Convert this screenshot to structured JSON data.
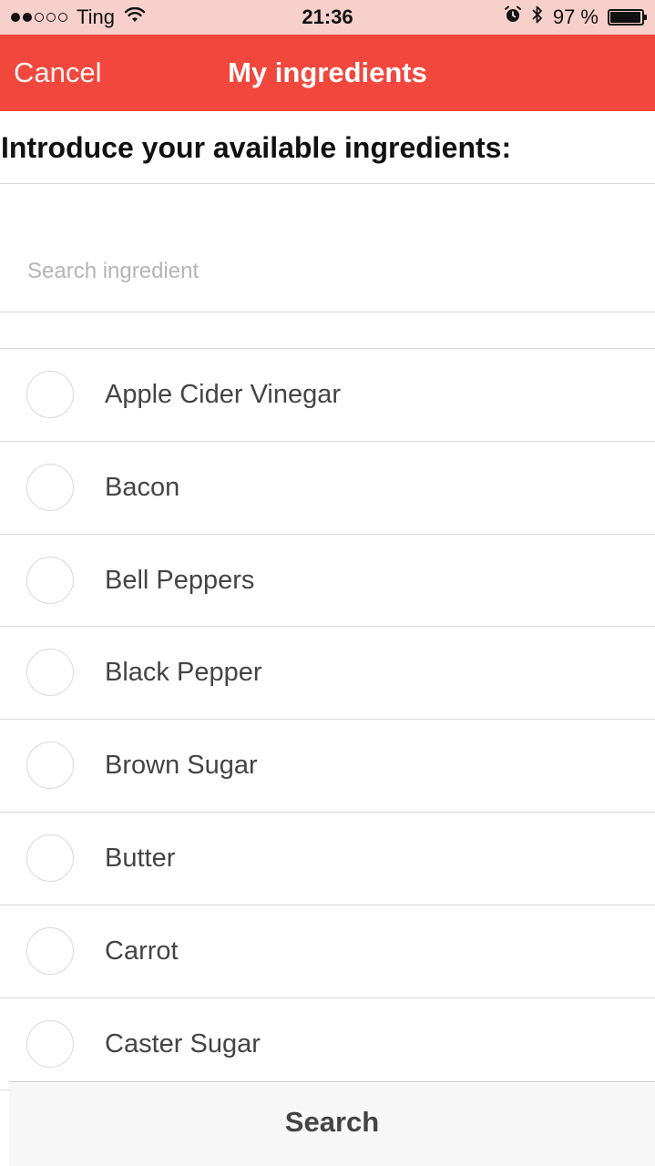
{
  "status_bar": {
    "carrier": "Ting",
    "signal_bars_filled": 2,
    "signal_bars_total": 5,
    "time": "21:36",
    "battery_percent": "97 %",
    "battery_level": 0.97,
    "icons": [
      "wifi-icon",
      "alarm-icon",
      "bluetooth-icon",
      "battery-icon"
    ]
  },
  "nav": {
    "cancel_label": "Cancel",
    "title": "My ingredients",
    "color": "#f2473c"
  },
  "heading": "Introduce your available ingredients:",
  "search": {
    "placeholder": "Search ingredient",
    "value": ""
  },
  "ingredients": [
    {
      "label": "Apple Cider Vinegar",
      "selected": false
    },
    {
      "label": "Bacon",
      "selected": false
    },
    {
      "label": "Bell Peppers",
      "selected": false
    },
    {
      "label": "Black Pepper",
      "selected": false
    },
    {
      "label": "Brown Sugar",
      "selected": false
    },
    {
      "label": "Butter",
      "selected": false
    },
    {
      "label": "Carrot",
      "selected": false
    },
    {
      "label": "Caster Sugar",
      "selected": false
    }
  ],
  "bottom_button": {
    "label": "Search"
  }
}
